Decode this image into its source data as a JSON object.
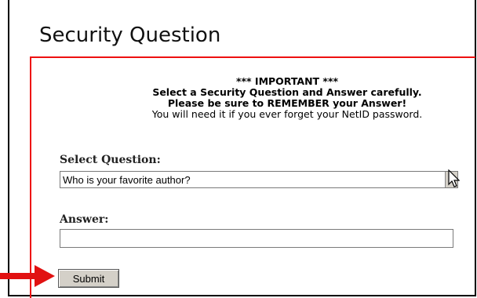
{
  "page": {
    "title": "Security Question"
  },
  "notice": {
    "line1": "*** IMPORTANT ***",
    "line2": "Select a Security Question and Answer carefully.",
    "line3": "Please be sure to REMEMBER your Answer!",
    "line4": "You will need it if you ever forget your NetID password."
  },
  "form": {
    "question_label": "Select Question:",
    "question_value": "Who is your favorite author?",
    "answer_label": "Answer:",
    "answer_value": "",
    "submit_label": "Submit"
  },
  "colors": {
    "frame": "#e11111",
    "annotation_arrow": "#e11111"
  },
  "icons": {
    "pointer": "mouse-pointer-icon",
    "annotation": "red-arrow-icon",
    "dropdown": "chevron-down-icon"
  }
}
